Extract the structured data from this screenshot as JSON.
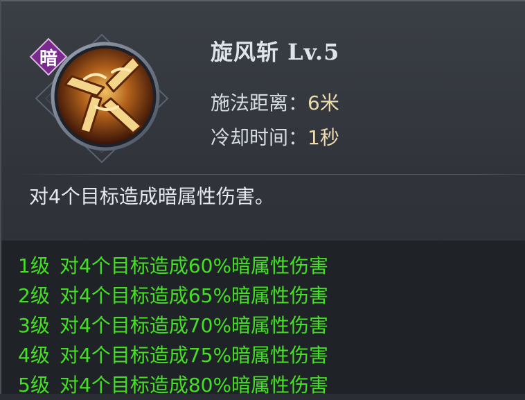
{
  "skill": {
    "element_badge": "暗",
    "icon": "whirlwind-blade-icon",
    "title": "旋风斩  Lv.5",
    "cast_range_label": "施法距离：",
    "cast_range_value": "6米",
    "cooldown_label": "冷却时间：",
    "cooldown_value": "1秒",
    "description": "对4个目标造成暗属性伤害。"
  },
  "levels": [
    {
      "level": "1级",
      "effect": "对4个目标造成60%暗属性伤害"
    },
    {
      "level": "2级",
      "effect": "对4个目标造成65%暗属性伤害"
    },
    {
      "level": "3级",
      "effect": "对4个目标造成70%暗属性伤害"
    },
    {
      "level": "4级",
      "effect": "对4个目标造成75%暗属性伤害"
    },
    {
      "level": "5级",
      "effect": "对4个目标造成80%暗属性伤害"
    }
  ],
  "colors": {
    "level_text": "#45e024",
    "stat_value": "#eedcb0",
    "badge": "#7a2a8c",
    "panel": "#33373d"
  }
}
